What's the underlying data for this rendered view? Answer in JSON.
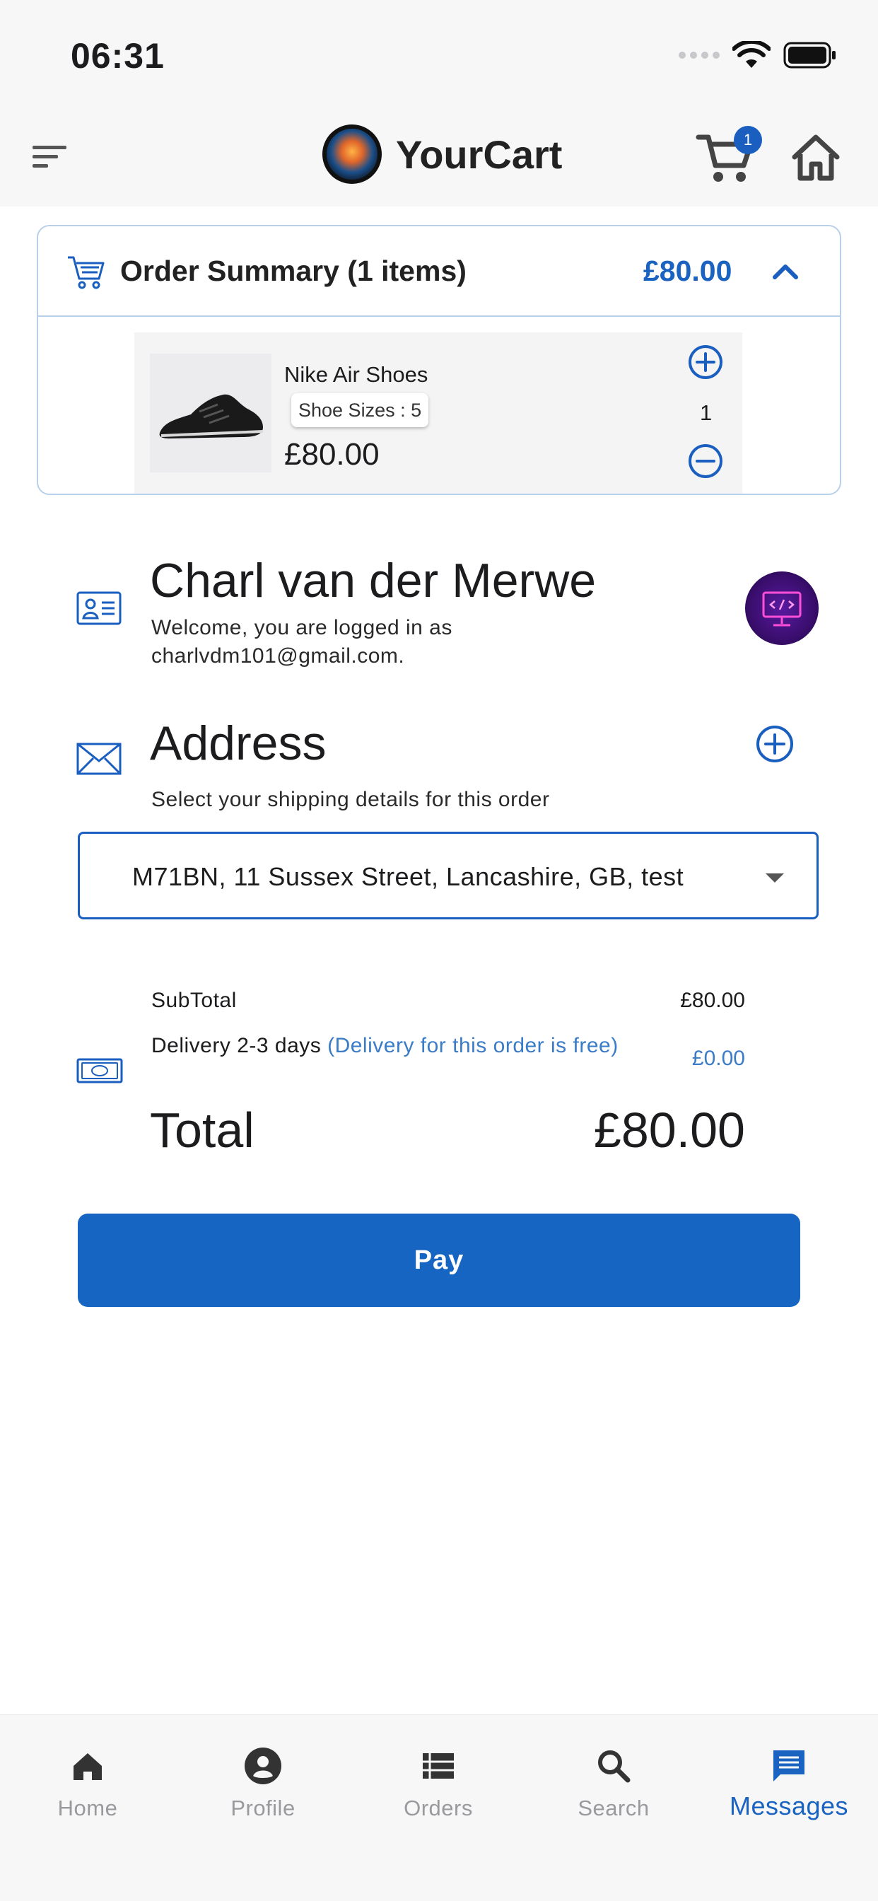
{
  "status_bar": {
    "time": "06:31"
  },
  "app_bar": {
    "brand_title": "YourCart",
    "cart_badge": "1",
    "icons": [
      "menu-icon",
      "cart-icon",
      "home-icon"
    ]
  },
  "order_summary": {
    "title": "Order Summary (1 items)",
    "total": "£80.00",
    "item": {
      "name": "Nike Air Shoes",
      "size_label": "Shoe Sizes : 5",
      "price": "£80.00",
      "quantity": "1"
    }
  },
  "user": {
    "name": "Charl van der Merwe",
    "welcome": "Welcome, you are logged in as charlvdm101@gmail.com."
  },
  "address": {
    "title": "Address",
    "hint": "Select your shipping details for this order",
    "selected": "M71BN, 11 Sussex Street, Lancashire, GB, test"
  },
  "totals": {
    "subtotal_label": "SubTotal",
    "subtotal_value": "£80.00",
    "delivery_label": "Delivery 2-3 days ",
    "delivery_note": "(Delivery for this order is free)",
    "delivery_value": "£0.00",
    "total_label": "Total",
    "total_value": "£80.00"
  },
  "pay_button": "Pay",
  "bottom_nav": {
    "items": [
      {
        "label": "Home",
        "icon": "home-icon"
      },
      {
        "label": "Profile",
        "icon": "profile-icon"
      },
      {
        "label": "Orders",
        "icon": "orders-icon"
      },
      {
        "label": "Search",
        "icon": "search-icon"
      },
      {
        "label": "Messages",
        "icon": "messages-icon"
      }
    ],
    "active": "Messages"
  },
  "colors": {
    "accent": "#1665c2",
    "link": "#3a7cc7",
    "inactive": "#9a9a9e",
    "card_border": "#b8d0ea"
  }
}
